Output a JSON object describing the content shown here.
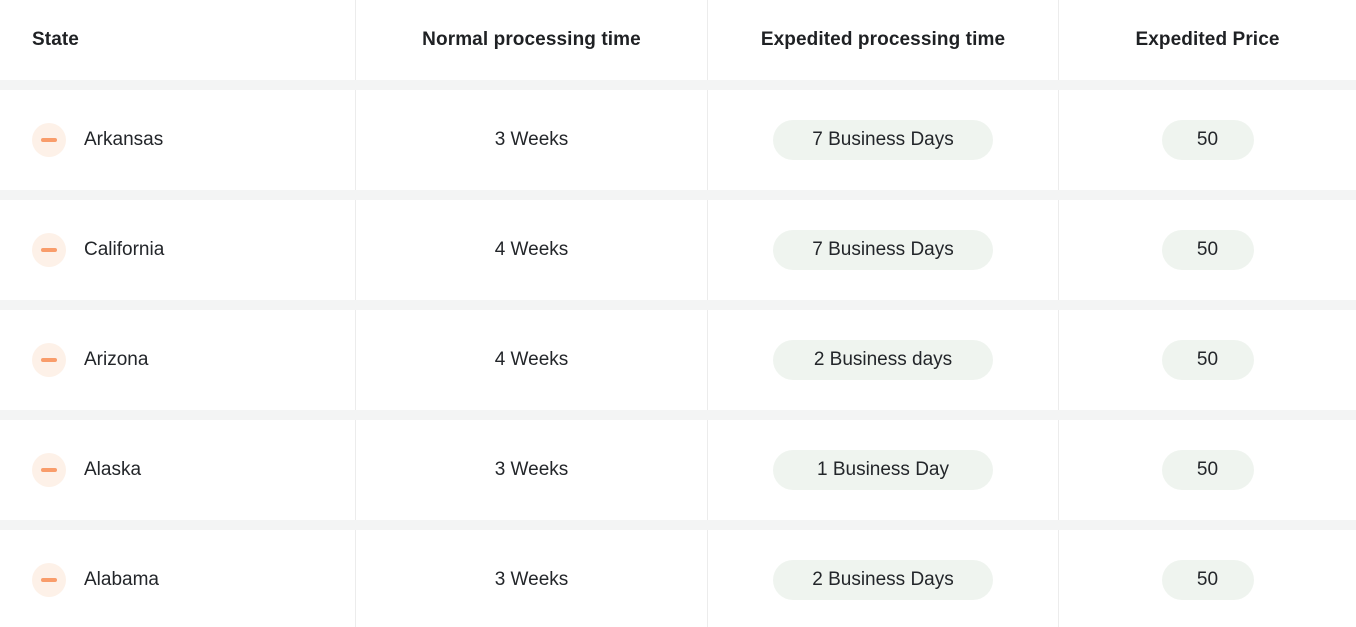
{
  "table": {
    "columns": [
      {
        "key": "state",
        "label": "State"
      },
      {
        "key": "normal",
        "label": "Normal processing time"
      },
      {
        "key": "expedited",
        "label": "Expedited processing time"
      },
      {
        "key": "price",
        "label": "Expedited Price"
      }
    ],
    "rows": [
      {
        "icon": "minus-circle-icon",
        "state": "Arkansas",
        "normal": "3 Weeks",
        "expedited": "7 Business Days",
        "price": "50"
      },
      {
        "icon": "minus-circle-icon",
        "state": "California",
        "normal": "4 Weeks",
        "expedited": "7 Business Days",
        "price": "50"
      },
      {
        "icon": "minus-circle-icon",
        "state": "Arizona",
        "normal": "4 Weeks",
        "expedited": "2 Business days",
        "price": "50"
      },
      {
        "icon": "minus-circle-icon",
        "state": "Alaska",
        "normal": "3 Weeks",
        "expedited": "1 Business Day",
        "price": "50"
      },
      {
        "icon": "minus-circle-icon",
        "state": "Alabama",
        "normal": "3 Weeks",
        "expedited": "2 Business Days",
        "price": "50"
      }
    ]
  },
  "colors": {
    "page_background": "#f3f4f4",
    "row_background": "#ffffff",
    "header_text": "#1f2124",
    "body_text": "#23262a",
    "icon_badge_background": "#fdf1e8",
    "icon_dash": "#f99d6b",
    "pill_background": "#eff4ef",
    "column_divider": "#ececec"
  }
}
